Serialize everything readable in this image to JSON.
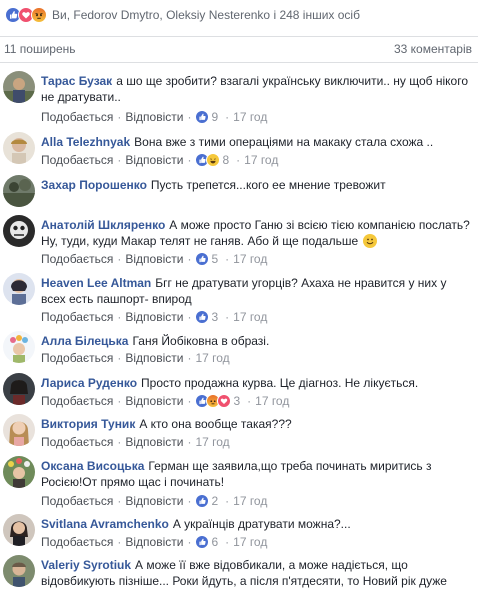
{
  "reactions": {
    "icons": [
      "like-icon",
      "love-icon",
      "angry-icon"
    ],
    "text": "Ви, Fedorov Dmytro, Oleksiy Nesterenko і 248 інших осіб"
  },
  "stats": {
    "shares": "11 поширень",
    "comments": "33 коментарів"
  },
  "actions": {
    "like": "Подобається",
    "reply": "Відповісти"
  },
  "comments": [
    {
      "name": "Тарас Бузак",
      "text": "а шо ще зробити? взагалі українську виключити.. ну щоб нікого не дратувати..",
      "reactions": [
        "like-icon"
      ],
      "count": "9",
      "time": "17 год"
    },
    {
      "name": "Alla Telezhnyak",
      "text": "Вона вже з тими операціями на макаку стала схожа ..",
      "reactions": [
        "like-icon",
        "haha-icon"
      ],
      "count": "8",
      "time": "17 год"
    },
    {
      "name": "Захар Порошенко",
      "text": "Пусть трепется...кого ее мнение тревожит",
      "reactions": [],
      "count": "",
      "time": ""
    },
    {
      "name": "Анатолій Шкляренко",
      "text": "А може просто Ганю зі всією тією компанією послать? Ну, туди, куди Макар телят не ганяв. Або й ще подальше",
      "emoji": "smile-emoji",
      "reactions": [
        "like-icon"
      ],
      "count": "5",
      "time": "17 год"
    },
    {
      "name": "Heaven Lee Altman",
      "text": "Бгг не дратувати угорців? Ахаха не нравится у них у всех есть пашпорт- впирод",
      "reactions": [
        "like-icon"
      ],
      "count": "3",
      "time": "17 год"
    },
    {
      "name": "Алла Білецька",
      "text": "Ганя Йобіковна в образі.",
      "reactions": [],
      "count": "",
      "time": "17 год"
    },
    {
      "name": "Лариса Руденко",
      "text": "Просто продажна курва. Це діагноз. Не лікується.",
      "reactions": [
        "like-icon",
        "angry-icon",
        "love-icon"
      ],
      "count": "3",
      "time": "17 год"
    },
    {
      "name": "Виктория Туник",
      "text": "А кто она вообще такая???",
      "reactions": [],
      "count": "",
      "time": "17 год"
    },
    {
      "name": "Оксана Висоцька",
      "text": "Герман ще заявила,що треба починать миритись з Росією!От прямо щас і починать!",
      "reactions": [
        "like-icon"
      ],
      "count": "2",
      "time": "17 год"
    },
    {
      "name": "Svitlana Avramchenko",
      "text": "А українців дратувати можна?...",
      "reactions": [
        "like-icon"
      ],
      "count": "6",
      "time": "17 год"
    },
    {
      "name": "Valeriy Syrotiuk",
      "text": "А може її вже відовбикали, а може надіється, що відовбикують пізніше... Роки йдуть, а після п'ятдесяти, то Новий рік дуже",
      "reactions": [],
      "count": "",
      "time": ""
    }
  ]
}
